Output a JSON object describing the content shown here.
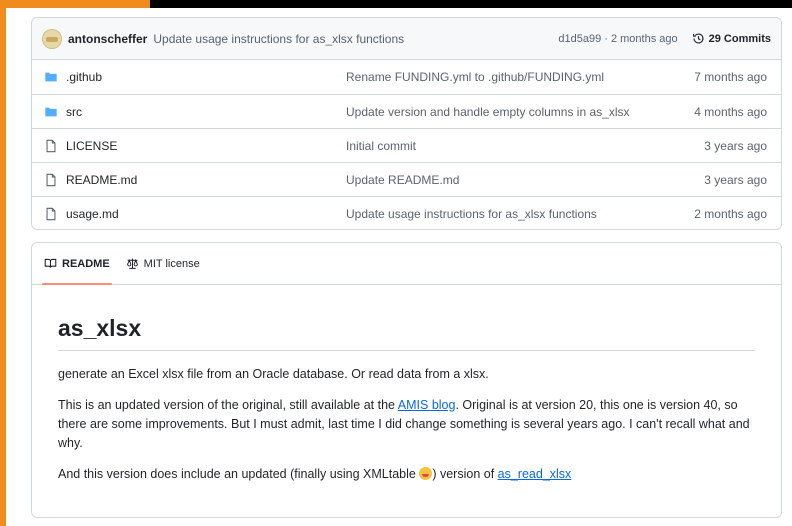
{
  "commit_bar": {
    "author": "antonscheffer",
    "message": "Update usage instructions for as_xlsx functions",
    "meta": "d1d5a99 · 2 months ago",
    "commits_label": "29 Commits"
  },
  "files": [
    {
      "type": "folder",
      "name": ".github",
      "commit": "Rename FUNDING.yml to .github/FUNDING.yml",
      "age": "7 months ago"
    },
    {
      "type": "folder",
      "name": "src",
      "commit": "Update version and handle empty columns in as_xlsx",
      "age": "4 months ago"
    },
    {
      "type": "file",
      "name": "LICENSE",
      "commit": "Initial commit",
      "age": "3 years ago"
    },
    {
      "type": "file",
      "name": "README.md",
      "commit": "Update README.md",
      "age": "3 years ago"
    },
    {
      "type": "file",
      "name": "usage.md",
      "commit": "Update usage instructions for as_xlsx functions",
      "age": "2 months ago"
    }
  ],
  "readme": {
    "tabs": [
      {
        "label": "README",
        "icon": "book-icon"
      },
      {
        "label": "MIT license",
        "icon": "scale-icon"
      }
    ],
    "title": "as_xlsx",
    "p1": "generate an Excel xlsx file from an Oracle database. Or read data from a xlsx.",
    "p2_before": "This is an updated version of the original, still available at the ",
    "p2_link": "AMIS blog",
    "p2_after": ". Original is at version 20, this one is version 40, so there are some improvements. But I must admit, last time I did change something is several years ago. I can't recall what and why.",
    "p3_before": "And this version does include an updated (finally using XMLtable ",
    "p3_middle": ") version of ",
    "p3_link": "as_read_xlsx"
  },
  "colors": {
    "accent_orange": "#f08c1e",
    "folder_blue": "#54aeff",
    "link_blue": "#0969da",
    "active_tab_underline": "#fd8c73"
  }
}
